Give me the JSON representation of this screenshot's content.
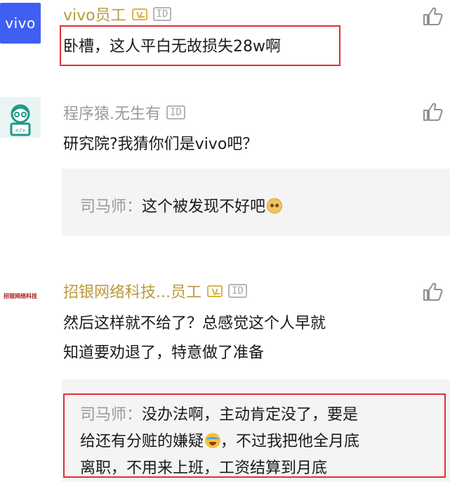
{
  "comments": [
    {
      "name": "vivo员工",
      "avatar_text": "vivo",
      "verified": true,
      "id_badge": "ID",
      "lines": [
        "卧槽，这人平白无故损失28w啊"
      ]
    },
    {
      "name": "程序猿.无生有",
      "verified": false,
      "id_badge": "ID",
      "lines": [
        "研究院?我猜你们是vivo吧？"
      ],
      "reply": {
        "author": "司马师：",
        "lines": [
          "这个被发现不好吧"
        ],
        "emoji": "shy-face-emoji"
      }
    },
    {
      "name": "招银网络科技...员工",
      "avatar_text": "招银网络科技",
      "verified": true,
      "id_badge": "ID",
      "lines": [
        "然后这样就不给了？总感觉这个人早就",
        "知道要劝退了，特意做了准备"
      ],
      "reply": {
        "author": "司马师：",
        "lines": [
          "没办法啊，主动肯定没了，要是",
          "给还有分赃的嫌疑",
          "，不过我把他全月底",
          "离职，不用来上班，工资结算到月底"
        ],
        "emoji": "laugh-cry-emoji"
      }
    }
  ],
  "colors": {
    "highlight": "#e0303a",
    "verified_name": "#b89a3d",
    "reply_bg": "#f4f4f4"
  },
  "icons": [
    "thumbs-up-icon",
    "verified-v-icon",
    "id-badge-icon"
  ]
}
